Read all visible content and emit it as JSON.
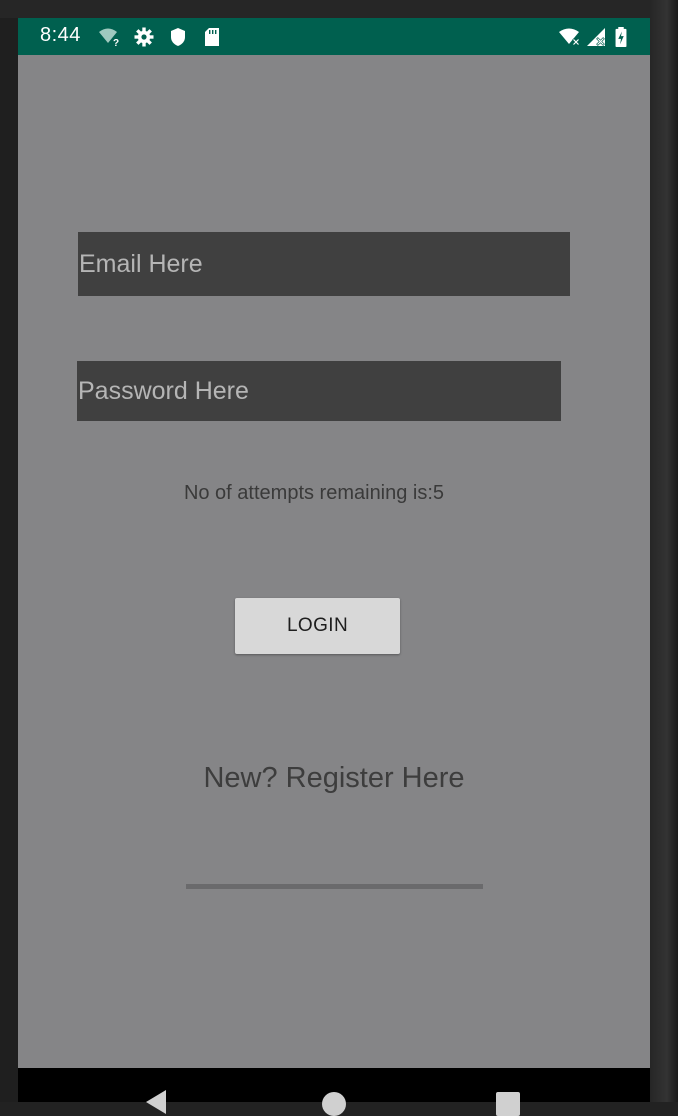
{
  "status_bar": {
    "time": "8:44",
    "background_color": "#00604f",
    "left_icons": [
      "wifi-unknown-icon",
      "settings-gear-icon",
      "shield-icon",
      "sd-card-icon"
    ],
    "right_icons": [
      "wifi-no-internet-icon",
      "cell-signal-no-data-icon",
      "battery-charging-icon"
    ]
  },
  "form": {
    "email_placeholder": "Email Here",
    "email_value": "",
    "password_placeholder": "Password Here",
    "password_value": "",
    "attempts_text": "No of attempts remaining is:5",
    "login_label": "LOGIN",
    "register_label": "New? Register Here",
    "progress_fraction": 1.0
  },
  "colors": {
    "screen_background": "#858587",
    "input_background": "#404040",
    "button_background": "#d8d8d8"
  },
  "nav_bar": {
    "buttons": [
      "back-icon",
      "home-icon",
      "recents-icon"
    ]
  }
}
